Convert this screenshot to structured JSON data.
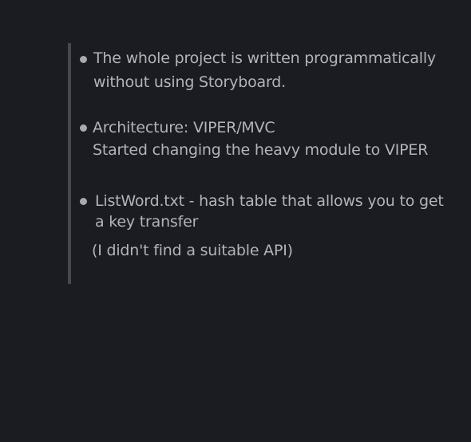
{
  "notes": {
    "items": [
      {
        "lines": [
          "The whole project is written programmatically",
          "without using Storyboard."
        ]
      },
      {
        "lines": [
          "Architecture: VIPER/MVC",
          "Started changing the heavy module to VIPER"
        ]
      },
      {
        "lines": [
          "ListWord.txt - hash table that allows you to get",
          "a key transfer"
        ]
      }
    ],
    "extra_line": "(I didn't find a suitable API)"
  }
}
